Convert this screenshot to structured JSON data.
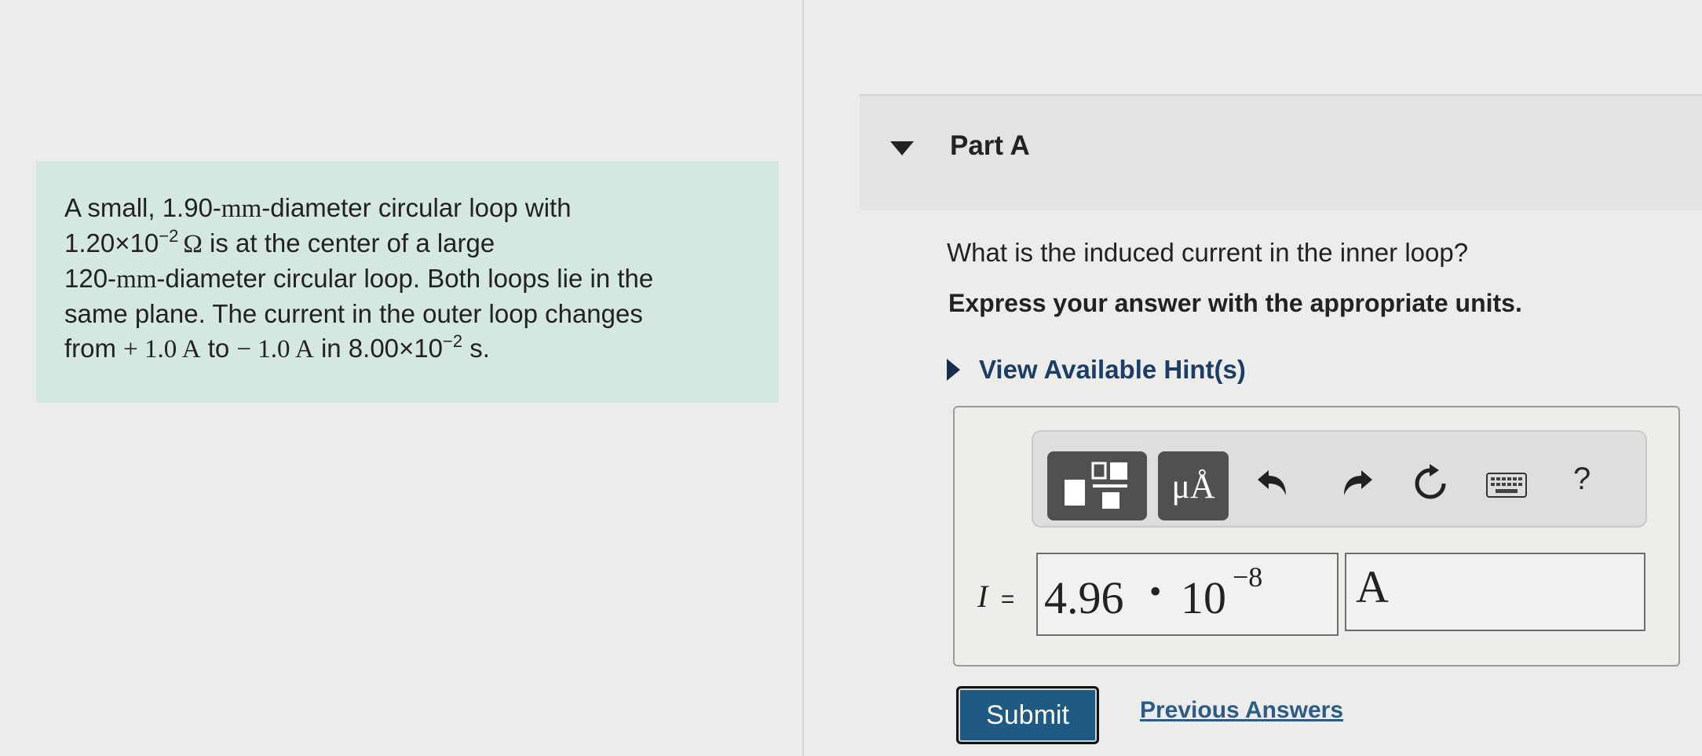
{
  "problem": {
    "l1_a": "A small, 1.90-",
    "l1_unit": "mm",
    "l1_b": "-diameter circular loop with",
    "l2_a": "1.20×10",
    "l2_exp": "−2",
    "l2_ohm": "Ω",
    "l2_b": " is at the center of a large",
    "l3_a": "120-",
    "l3_unit": "mm",
    "l3_b": "-diameter circular loop. Both loops lie in the",
    "l4": "same plane. The current in the outer loop changes",
    "l5_a": "from ",
    "l5_m1": "+ 1.0 A",
    "l5_b": " to ",
    "l5_m2": "− 1.0 A",
    "l5_c": " in 8.00×10",
    "l5_exp": "−2",
    "l5_d": " s."
  },
  "part": {
    "title": "Part A",
    "question": "What is the induced current in the inner loop?",
    "instruction": "Express your answer with the appropriate units.",
    "hint_label": "View Available Hint(s)"
  },
  "toolbar": {
    "units_label": "μÅ",
    "help_label": "?"
  },
  "answer": {
    "variable": "I",
    "equals": "=",
    "mantissa": "4.96",
    "dot": "•",
    "base": "10",
    "exponent": "−8",
    "units": "A"
  },
  "buttons": {
    "submit": "Submit",
    "previous_answers": "Previous Answers"
  },
  "colors": {
    "problem_bg": "#d5e7e2",
    "submit_bg": "#1f5a84",
    "link": "#2b5b86",
    "toolbar_button": "#4f5050"
  }
}
